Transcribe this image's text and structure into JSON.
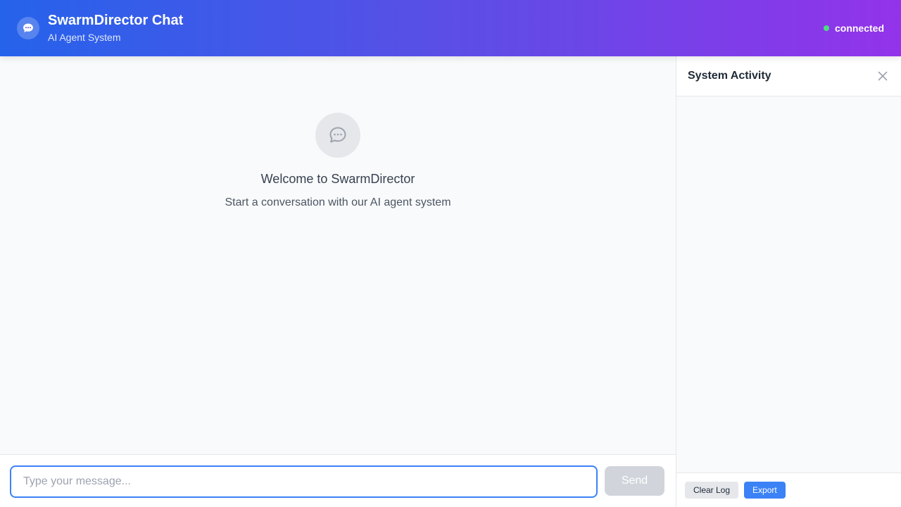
{
  "header": {
    "title": "SwarmDirector Chat",
    "subtitle": "AI Agent System",
    "logo_icon": "chat-bubble-icon",
    "status": "connected",
    "status_color": "#4ade80"
  },
  "welcome": {
    "icon": "chat-bubble-icon",
    "title": "Welcome to SwarmDirector",
    "subtitle": "Start a conversation with our AI agent system"
  },
  "composer": {
    "placeholder": "Type your message...",
    "value": "",
    "send_label": "Send"
  },
  "activity_panel": {
    "title": "System Activity",
    "close_icon": "close-icon",
    "entries": [],
    "clear_label": "Clear Log",
    "export_label": "Export"
  },
  "colors": {
    "accent": "#3b82f6",
    "gradient_start": "#2563eb",
    "gradient_end": "#9333ea"
  }
}
